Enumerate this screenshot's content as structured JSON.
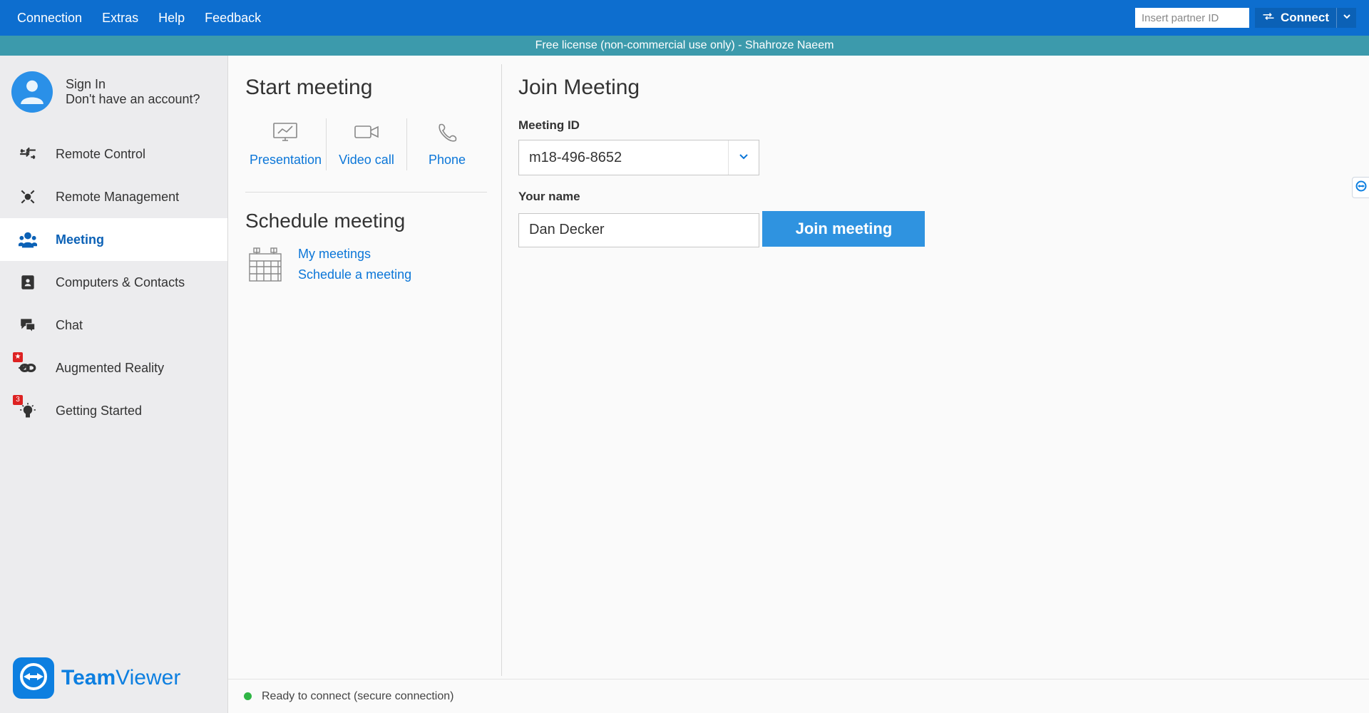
{
  "menubar": {
    "items": [
      "Connection",
      "Extras",
      "Help",
      "Feedback"
    ],
    "partner_placeholder": "Insert partner ID",
    "connect_label": "Connect"
  },
  "license_bar": "Free license (non-commercial use only) - Shahroze Naeem",
  "account": {
    "sign_in": "Sign In",
    "no_account": "Don't have an account?"
  },
  "nav": {
    "remote_control": "Remote Control",
    "remote_management": "Remote Management",
    "meeting": "Meeting",
    "computers_contacts": "Computers & Contacts",
    "chat": "Chat",
    "augmented_reality": "Augmented Reality",
    "getting_started": "Getting Started",
    "ar_badge": "★",
    "gs_badge": "3"
  },
  "brand": {
    "bold": "Team",
    "light": "Viewer"
  },
  "start_meeting": {
    "title": "Start meeting",
    "presentation": "Presentation",
    "video_call": "Video call",
    "phone": "Phone"
  },
  "schedule_meeting": {
    "title": "Schedule meeting",
    "my_meetings": "My meetings",
    "schedule_link": "Schedule a meeting"
  },
  "join_meeting": {
    "title": "Join Meeting",
    "meeting_id_label": "Meeting ID",
    "meeting_id_value": "m18-496-8652",
    "your_name_label": "Your name",
    "your_name_value": "Dan Decker",
    "join_button": "Join meeting"
  },
  "status": "Ready to connect (secure connection)"
}
